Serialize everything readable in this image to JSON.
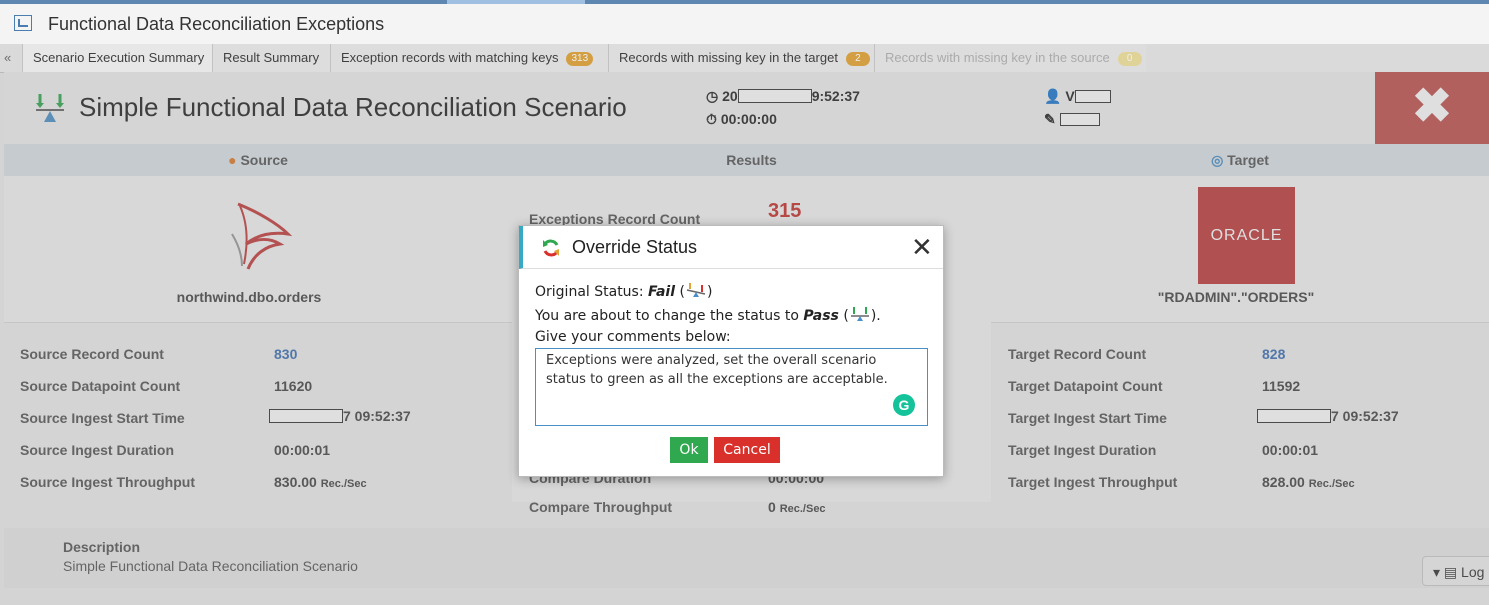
{
  "window": {
    "title": "Functional Data Reconciliation Exceptions"
  },
  "tabs": [
    {
      "label": "Scenario Execution Summary",
      "badge": null
    },
    {
      "label": "Result Summary",
      "badge": null
    },
    {
      "label": "Exception records with matching keys",
      "badge": "313"
    },
    {
      "label": "Records with missing key in the target",
      "badge": "2"
    },
    {
      "label": "Records with missing key in the source",
      "badge": "0"
    }
  ],
  "scenario": {
    "title": "Simple Functional Data Reconciliation Scenario",
    "start_time_prefix": "20",
    "start_time_suffix": "9:52:37",
    "duration": "00:00:00",
    "user_prefix": "V"
  },
  "columns": {
    "source": "Source",
    "results": "Results",
    "target": "Target"
  },
  "source": {
    "name": "northwind.dbo.orders",
    "stats": [
      {
        "label": "Source Record Count",
        "value": "830"
      },
      {
        "label": "Source Datapoint Count",
        "value": "11620"
      },
      {
        "label": "Source Ingest Start Time",
        "value": "7 09:52:37"
      },
      {
        "label": "Source Ingest Duration",
        "value": "00:00:01"
      },
      {
        "label": "Source Ingest Throughput",
        "value": "830.00",
        "unit": "Rec./Sec"
      }
    ]
  },
  "results": {
    "exceptions_label": "Exceptions Record Count",
    "exceptions_value": "315",
    "compare_duration_label": "Compare Duration",
    "compare_duration_value": "00:00:00",
    "throughput_label": "Compare Throughput",
    "throughput_value": "0",
    "throughput_unit": "Rec./Sec"
  },
  "target": {
    "logo_text": "ORACLE",
    "name": "\"RDADMIN\".\"ORDERS\"",
    "stats": [
      {
        "label": "Target Record Count",
        "value": "828"
      },
      {
        "label": "Target Datapoint Count",
        "value": "11592"
      },
      {
        "label": "Target Ingest Start Time",
        "value": "7 09:52:37"
      },
      {
        "label": "Target Ingest Duration",
        "value": "00:00:01"
      },
      {
        "label": "Target Ingest Throughput",
        "value": "828.00",
        "unit": "Rec./Sec"
      }
    ]
  },
  "description": {
    "label": "Description",
    "text": "Simple Functional Data Reconciliation Scenario"
  },
  "log_button": "Log",
  "modal": {
    "title": "Override Status",
    "original_prefix": "Original Status: ",
    "original_status": "Fail",
    "change_prefix": "You are about to change the status to ",
    "new_status": "Pass",
    "comment_prompt": "Give your comments below:",
    "comment_value": "Exceptions were analyzed, set the overall scenario status to green as all the exceptions are acceptable.",
    "ok_label": "Ok",
    "cancel_label": "Cancel"
  },
  "colors": {
    "accent": "#36a9c4",
    "fail": "#d9302b",
    "pass": "#2fa84f",
    "close_bg": "#c0504d",
    "link_value": "#3b6fb6",
    "exceptions": "#c6302b",
    "oracle": "#c0393b",
    "badge_orange": "#e0a336",
    "badge_yellow": "#e4c04a"
  }
}
